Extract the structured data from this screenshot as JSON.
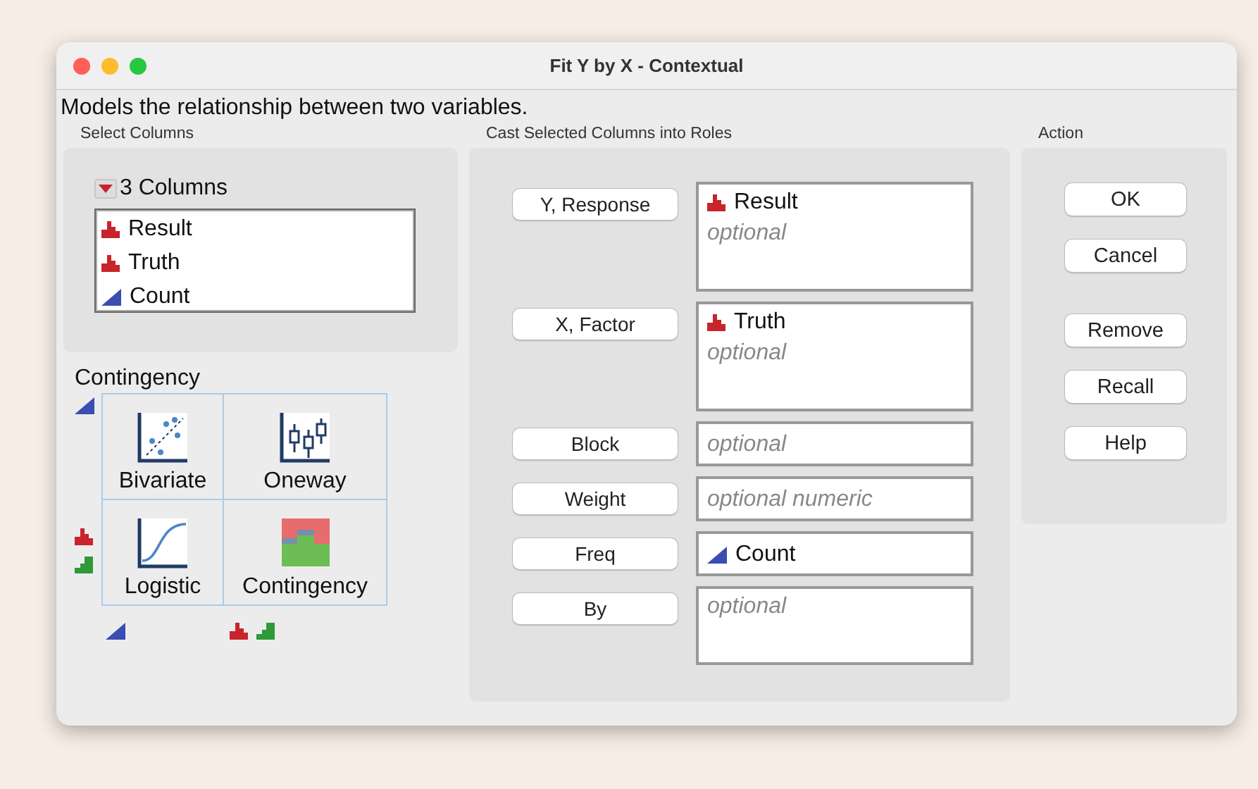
{
  "window": {
    "title": "Fit Y by X - Contextual"
  },
  "description": "Models the relationship between two variables.",
  "select_columns": {
    "heading": "Select Columns",
    "count_label": "3 Columns",
    "columns": [
      {
        "name": "Result",
        "kind": "nominal"
      },
      {
        "name": "Truth",
        "kind": "nominal"
      },
      {
        "name": "Count",
        "kind": "continuous"
      }
    ]
  },
  "platform": {
    "title": "Contingency",
    "y_types": [
      {
        "markers": [
          {
            "kind": "continuous"
          }
        ]
      },
      {
        "markers": [
          {
            "kind": "nominal"
          },
          {
            "kind": "ordinal"
          }
        ]
      }
    ],
    "x_types": [
      {
        "markers": [
          {
            "kind": "continuous"
          }
        ]
      },
      {
        "markers": [
          {
            "kind": "nominal"
          },
          {
            "kind": "ordinal"
          }
        ]
      }
    ],
    "cells": [
      {
        "label": "Bivariate",
        "kind": "scatter"
      },
      {
        "label": "Oneway",
        "kind": "boxes"
      },
      {
        "label": "Logistic",
        "kind": "sigmoid"
      },
      {
        "label": "Contingency",
        "kind": "mosaic"
      }
    ]
  },
  "roles": {
    "heading": "Cast Selected Columns into Roles",
    "rows": [
      {
        "label": "Y, Response",
        "kind": "tall",
        "values": [
          {
            "name": "Result",
            "kind": "nominal"
          }
        ],
        "placeholder": "optional"
      },
      {
        "label": "X, Factor",
        "kind": "tall",
        "values": [
          {
            "name": "Truth",
            "kind": "nominal"
          }
        ],
        "placeholder": "optional"
      },
      {
        "label": "Block",
        "kind": "short",
        "placeholder": "optional"
      },
      {
        "label": "Weight",
        "kind": "short",
        "placeholder": "optional numeric"
      },
      {
        "label": "Freq",
        "kind": "short",
        "values": [
          {
            "name": "Count",
            "kind": "continuous"
          }
        ]
      },
      {
        "label": "By",
        "kind": "tall-small",
        "placeholder": "optional"
      }
    ]
  },
  "action": {
    "heading": "Action",
    "groups": [
      {
        "buttons": [
          "OK",
          "Cancel"
        ]
      },
      {
        "buttons": [
          "Remove",
          "Recall",
          "Help"
        ]
      }
    ]
  }
}
